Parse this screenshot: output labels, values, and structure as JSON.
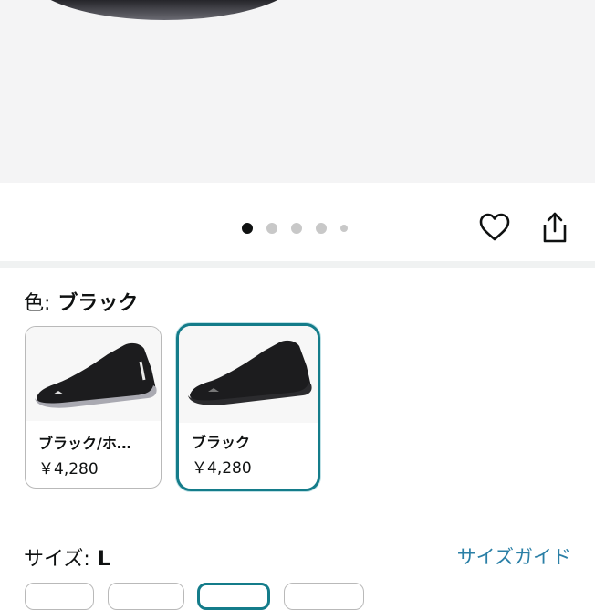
{
  "hero": {
    "image": "product-shoe-photo"
  },
  "carousel": {
    "dot_count": 5,
    "active_index": 0
  },
  "actions": {
    "favorite_icon": "heart-icon",
    "share_icon": "share-icon"
  },
  "color": {
    "label": "色:",
    "selected": "ブラック",
    "options": [
      {
        "name": "ブラック/ホ…",
        "price": "￥4,280",
        "selected": false
      },
      {
        "name": "ブラック",
        "price": "￥4,280",
        "selected": true
      }
    ]
  },
  "size": {
    "label": "サイズ:",
    "selected": "L",
    "guide_link": "サイズガイド"
  },
  "colors": {
    "accent": "#147c8a",
    "link": "#2a7fa6"
  }
}
